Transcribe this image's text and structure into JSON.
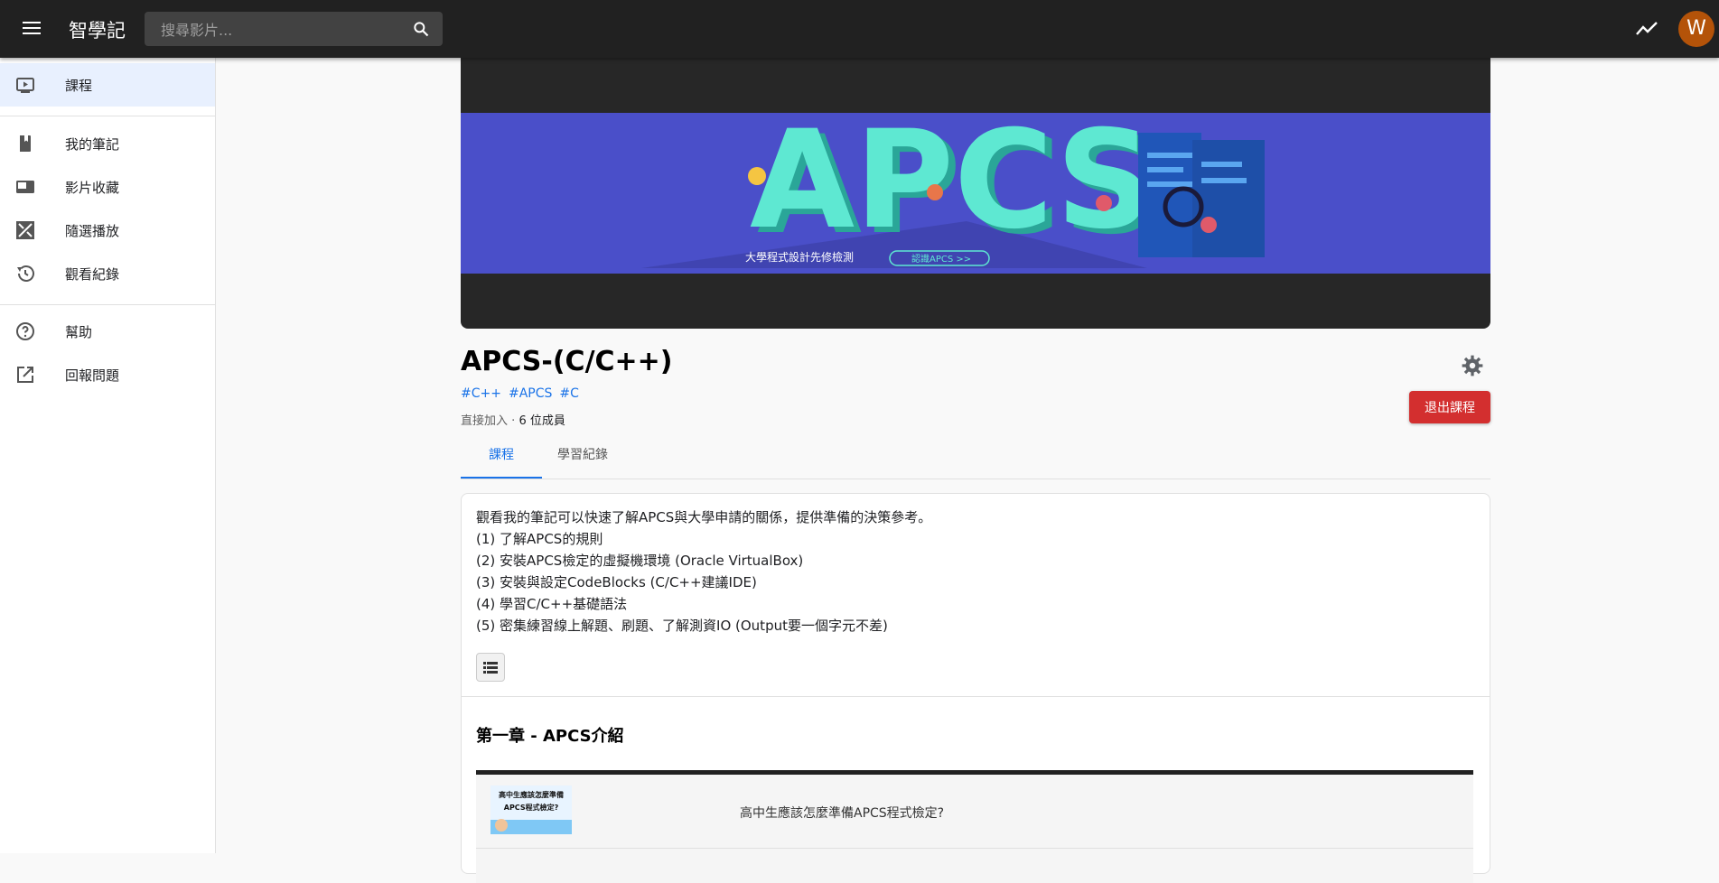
{
  "header": {
    "app_title": "智學記",
    "search_placeholder": "搜尋影片...",
    "avatar_letter": "W",
    "icons": [
      "menu-icon",
      "search-icon",
      "trending-icon"
    ]
  },
  "sidebar": {
    "items": [
      {
        "label": "課程",
        "icon": "video-library-icon",
        "active": true
      },
      {
        "label": "我的筆記",
        "icon": "book-icon"
      },
      {
        "label": "影片收藏",
        "icon": "video-collection-icon"
      },
      {
        "label": "隨選播放",
        "icon": "shuffle-icon"
      },
      {
        "label": "觀看紀錄",
        "icon": "history-icon"
      },
      {
        "label": "幫助",
        "icon": "help-icon"
      },
      {
        "label": "回報問題",
        "icon": "open-external-icon"
      }
    ]
  },
  "banner": {
    "logo_text": "APCS",
    "caption": "大學程式設計先修檢測",
    "cta": "認識APCS >>"
  },
  "course": {
    "title": "APCS-(C/C++)",
    "tags": [
      "#C++",
      "#APCS",
      "#C"
    ],
    "join_type": "直接加入",
    "separator": "·",
    "members": "6 位成員",
    "leave_button": "退出課程"
  },
  "tabs": [
    "課程",
    "學習紀錄"
  ],
  "description": [
    "觀看我的筆記可以快速了解APCS與大學申請的關係，提供準備的決策參考。",
    "(1) 了解APCS的規則",
    "(2) 安裝APCS檢定的虛擬機環境 (Oracle VirtualBox)",
    "(3) 安裝與設定CodeBlocks (C/C++建議IDE)",
    "(4) 學習C/C++基礎語法",
    "(5) 密集練習線上解題、刷題、了解測資IO (Output要一個字元不差)"
  ],
  "chapter": {
    "title": "第一章 - APCS介紹",
    "videos": [
      {
        "title": "高中生應該怎麼準備APCS程式檢定?",
        "thumb_line1": "高中生應該怎麼準備",
        "thumb_line2": "APCS程式檢定?"
      }
    ]
  },
  "colors": {
    "topbar": "#212121",
    "banner_bg": "#4a4fc9",
    "accent": "#1a73e8",
    "danger": "#d32f2f",
    "avatar": "#b45309"
  }
}
